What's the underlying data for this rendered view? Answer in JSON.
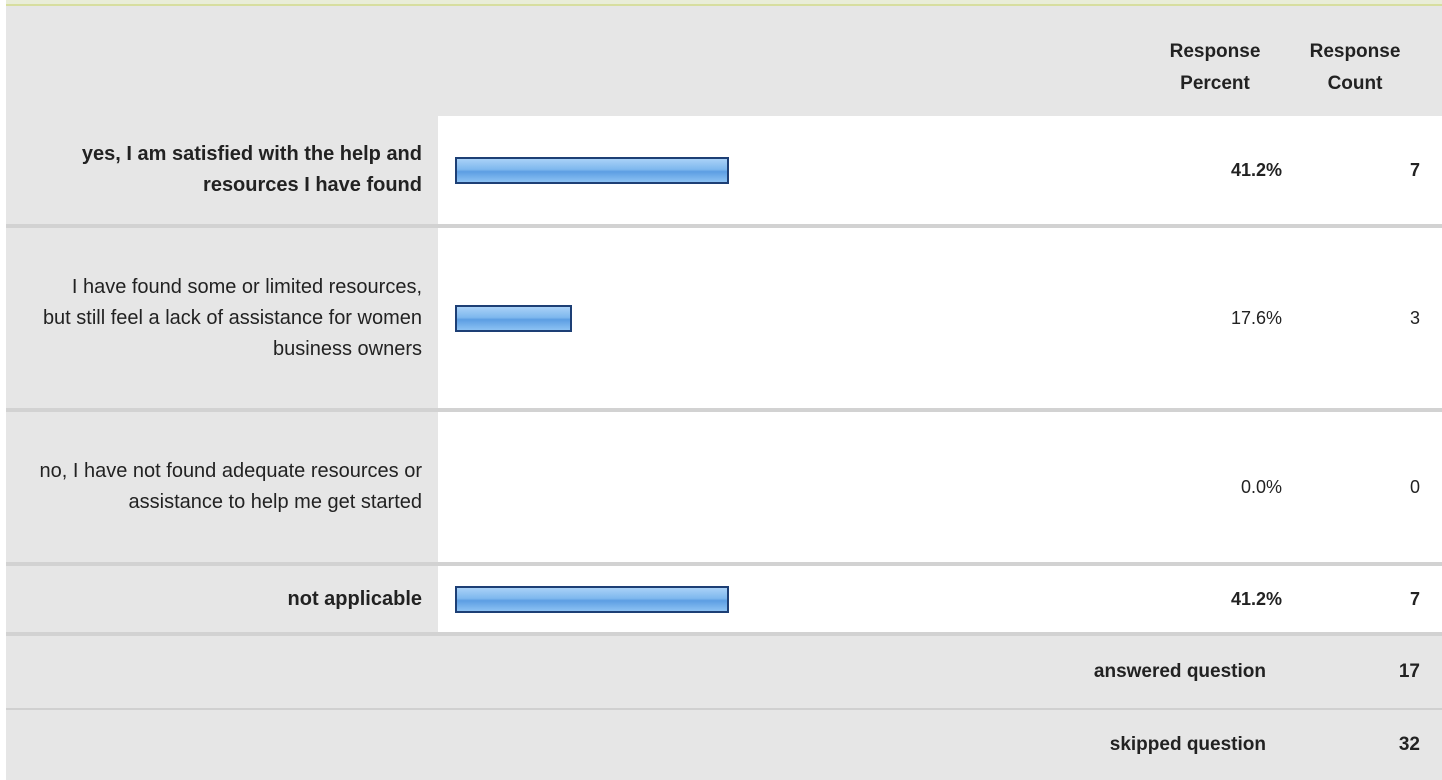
{
  "header": {
    "response_percent": "Response Percent",
    "response_count": "Response Count"
  },
  "chart_data": {
    "type": "bar",
    "categories": [
      "yes, I am satisfied with the help and resources I have found",
      "I have found some or limited resources, but still feel a lack of assistance for women business owners",
      "no, I have not found adequate resources or assistance to help me get started",
      "not applicable"
    ],
    "values": [
      41.2,
      17.6,
      0.0,
      41.2
    ],
    "value_labels": [
      "41.2%",
      "17.6%",
      "0.0%",
      "41.2%"
    ],
    "counts": [
      "7",
      "3",
      "0",
      "7"
    ],
    "bold": [
      true,
      false,
      false,
      true
    ],
    "ylim": [
      0,
      100
    ],
    "bar_color": "#7fb8ee",
    "bar_border": "#1d3f75"
  },
  "summary": {
    "answered_label": "answered question",
    "answered_value": "17",
    "skipped_label": "skipped question",
    "skipped_value": "32"
  }
}
